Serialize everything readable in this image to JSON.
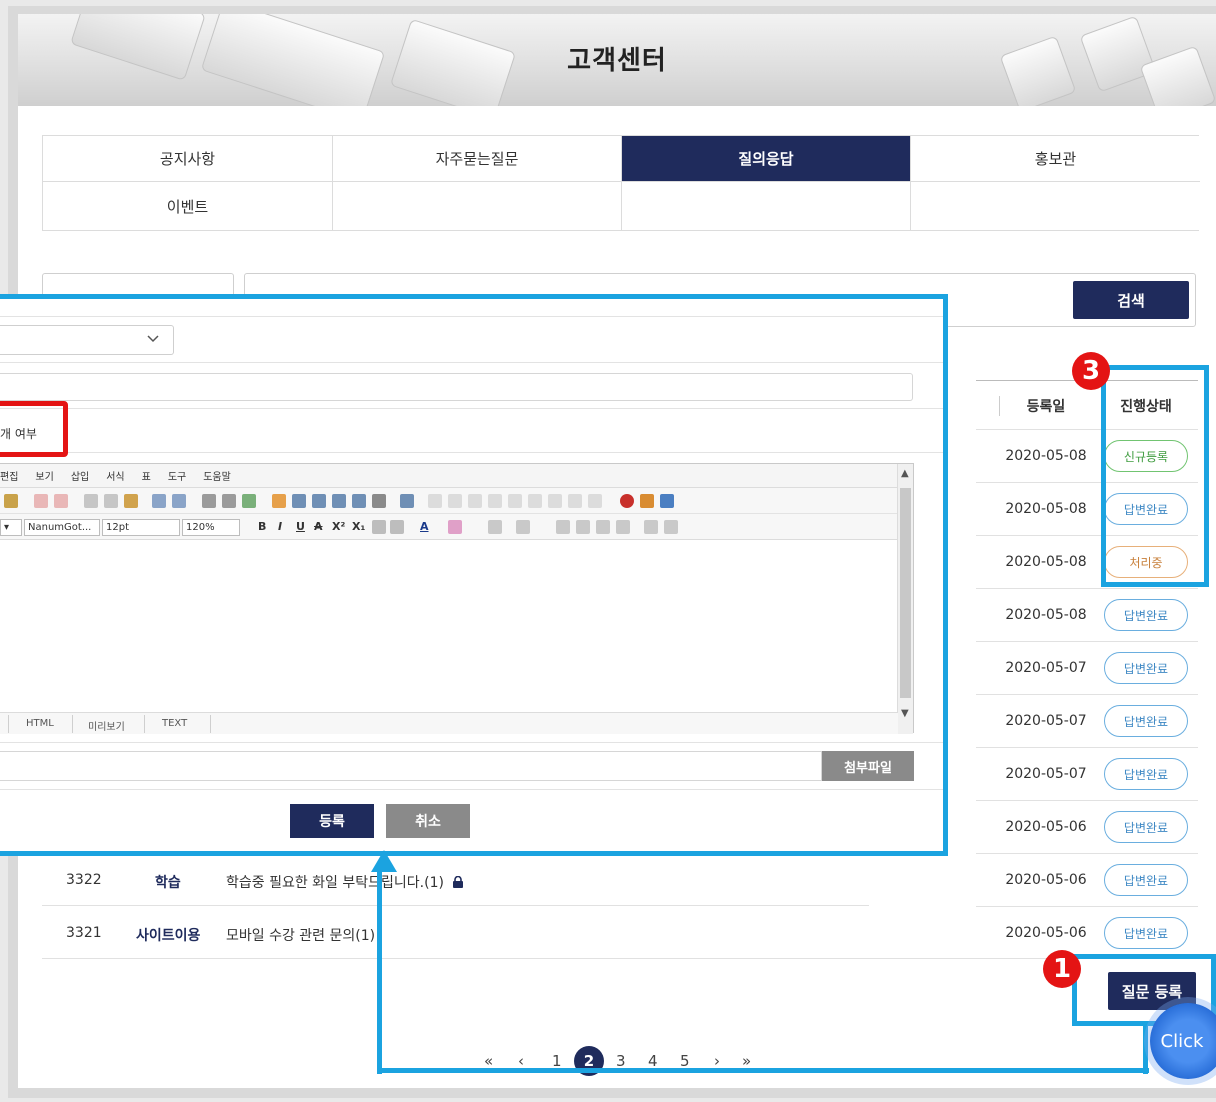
{
  "banner": {
    "title": "고객센터"
  },
  "tabs": [
    {
      "label": "공지사항",
      "active": false
    },
    {
      "label": "자주묻는질문",
      "active": false
    },
    {
      "label": "질의응답",
      "active": true
    },
    {
      "label": "홍보관",
      "active": false
    },
    {
      "label": "이벤트",
      "active": false
    }
  ],
  "search": {
    "button_label": "검색"
  },
  "table": {
    "headers": {
      "date": "등록일",
      "status": "진행상태"
    },
    "rows": [
      {
        "date": "2020-05-08",
        "status": "신규등록",
        "status_type": "new"
      },
      {
        "date": "2020-05-08",
        "status": "답변완료",
        "status_type": "done"
      },
      {
        "date": "2020-05-08",
        "status": "처리중",
        "status_type": "proc"
      },
      {
        "date": "2020-05-08",
        "status": "답변완료",
        "status_type": "done"
      },
      {
        "date": "2020-05-07",
        "status": "답변완료",
        "status_type": "done"
      },
      {
        "date": "2020-05-07",
        "status": "답변완료",
        "status_type": "done"
      },
      {
        "date": "2020-05-07",
        "status": "답변완료",
        "status_type": "done"
      },
      {
        "date": "2020-05-06",
        "status": "답변완료",
        "status_type": "done"
      },
      {
        "date": "2020-05-06",
        "status": "답변완료",
        "status_type": "done",
        "no": "3322",
        "category": "학습",
        "title": "학습중 필요한 화일 부탁드립니다.(1)",
        "locked": true
      },
      {
        "date": "2020-05-06",
        "status": "답변완료",
        "status_type": "done",
        "no": "3321",
        "category": "사이트이용",
        "title": "모바일 수강 관련 문의(1)",
        "locked": false
      }
    ]
  },
  "ask_button_label": "질문 등록",
  "pagination": {
    "first": "«",
    "prev": "‹",
    "pages": [
      "1",
      "2",
      "3",
      "4",
      "5"
    ],
    "current": "2",
    "next": "›",
    "last": "»"
  },
  "dialog": {
    "checkbox_text": "개 여부",
    "editor": {
      "menu": [
        "편집",
        "보기",
        "삽입",
        "서식",
        "표",
        "도구",
        "도움말"
      ],
      "font_family": "NanumGot...",
      "font_size": "12pt",
      "line_height": "120%",
      "modes": [
        "HTML",
        "미리보기",
        "TEXT"
      ]
    },
    "attach_button_label": "첨부파일",
    "submit_label": "등록",
    "cancel_label": "취소"
  },
  "annotations": {
    "step1": "1",
    "step3": "3",
    "click_label": "Click"
  },
  "colors": {
    "navy": "#1f2b5c",
    "highlight_blue": "#1ba3e0",
    "marker_red": "#e41414"
  }
}
